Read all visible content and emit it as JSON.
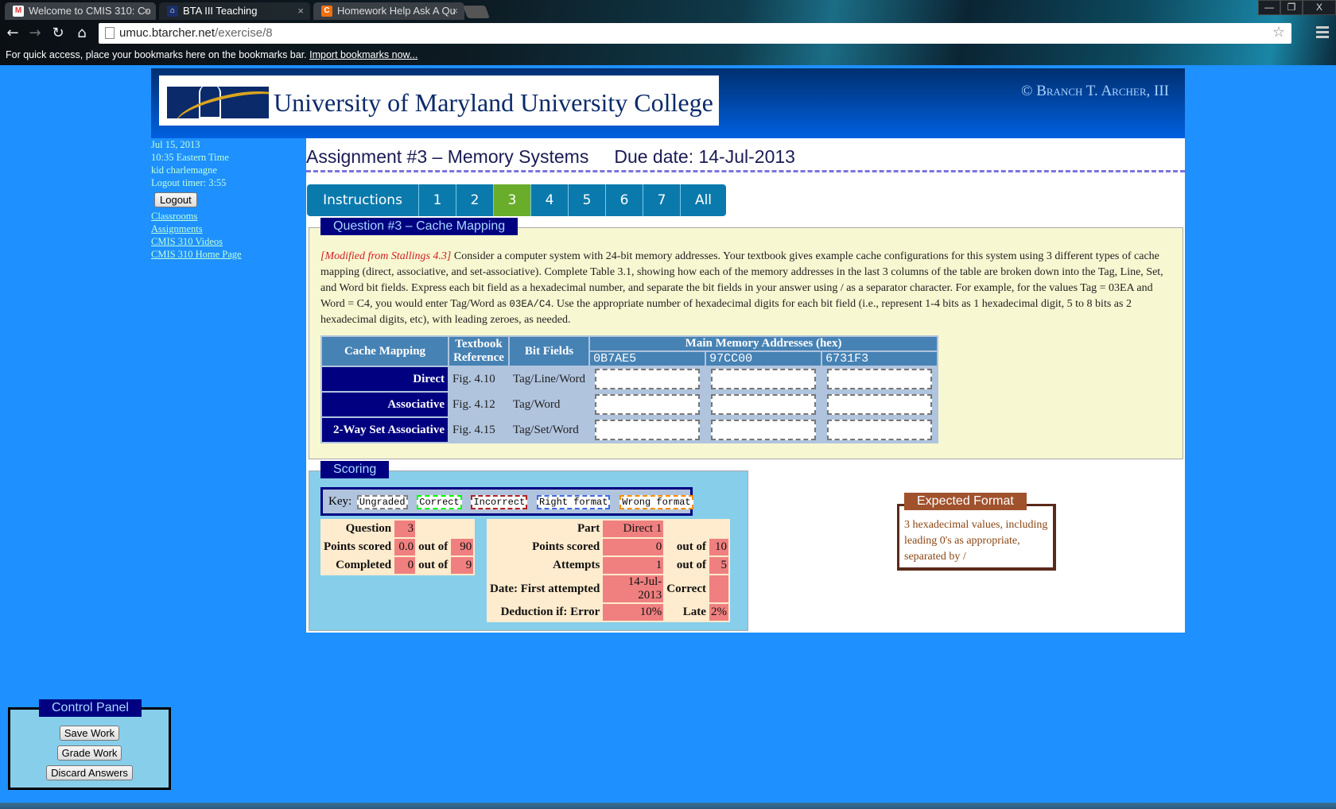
{
  "browser": {
    "tabs": [
      {
        "label": "Welcome to CMIS 310: Co",
        "icon": "gmail-icon",
        "active": false
      },
      {
        "label": "BTA III Teaching",
        "icon": "bta-icon",
        "active": true
      },
      {
        "label": "Homework Help Ask A Qu",
        "icon": "chegg-icon",
        "active": false
      }
    ],
    "url_domain": "umuc.btarcher.net",
    "url_path": "/exercise/8",
    "bookmarks_text": "For quick access, place your bookmarks here on the bookmarks bar. ",
    "bookmarks_link": "Import bookmarks now...",
    "window_controls": {
      "minimize": "—",
      "restore": "❐",
      "close": "X"
    }
  },
  "banner": {
    "logo_text": "University of Maryland University College",
    "copyright": "© Branch T. Archer, III"
  },
  "sidebar": {
    "date": "Jul 15, 2013",
    "time": "10:35 Eastern Time",
    "user": "kid charlemagne",
    "logout_timer": "Logout timer: 3:55",
    "logout_label": "Logout",
    "links": [
      "Classrooms",
      "Assignments",
      "CMIS 310 Videos",
      "CMIS 310 Home Page"
    ]
  },
  "main": {
    "title": "Assignment #3 – Memory Systems",
    "due": "Due date: 14-Jul-2013",
    "tabs": [
      {
        "label": "Instructions",
        "active": false
      },
      {
        "label": "1",
        "active": false
      },
      {
        "label": "2",
        "active": false
      },
      {
        "label": "3",
        "active": true
      },
      {
        "label": "4",
        "active": false
      },
      {
        "label": "5",
        "active": false
      },
      {
        "label": "6",
        "active": false
      },
      {
        "label": "7",
        "active": false
      },
      {
        "label": "All",
        "active": false
      }
    ]
  },
  "question": {
    "heading": "Question #3 – Cache Mapping",
    "source": "[Modified from Stallings 4.3]",
    "text1": " Consider a computer system with 24-bit memory addresses.  Your textbook gives example cache configurations for this system using 3 different types of cache mapping (direct, associative, and set-associative).  Complete Table 3.1, showing how each of the memory addresses in the last 3 columns of the table are broken down into the Tag, Line, Set, and Word bit fields.  Express each bit field as a hexadecimal number, and separate the bit fields in your answer using / as a separator character.  For example, for the values Tag = 03EA and Word = C4, you would enter Tag/Word as ",
    "example_code": "03EA/C4",
    "text2": ".  Use the appropriate number of hexadecimal digits for each bit field (i.e., represent 1-4 bits as 1 hexadecimal digit, 5 to 8 bits as 2 hexadecimal digits, etc), with leading zeroes, as needed.",
    "table": {
      "headers": {
        "mapping": "Cache Mapping",
        "reference": "Textbook Reference",
        "fields": "Bit Fields",
        "addresses": "Main Memory Addresses (hex)"
      },
      "addresses": [
        "0B7AE5",
        "97CC00",
        "6731F3"
      ],
      "rows": [
        {
          "mapping": "Direct",
          "reference": "Fig. 4.10",
          "fields": "Tag/Line/Word",
          "values": [
            "",
            "",
            ""
          ]
        },
        {
          "mapping": "Associative",
          "reference": "Fig. 4.12",
          "fields": "Tag/Word",
          "values": [
            "",
            "",
            ""
          ]
        },
        {
          "mapping": "2-Way Set Associative",
          "reference": "Fig. 4.15",
          "fields": "Tag/Set/Word",
          "values": [
            "",
            "",
            ""
          ]
        }
      ]
    }
  },
  "scoring": {
    "heading": "Scoring",
    "key_label": "Key:",
    "keys": [
      {
        "label": "Ungraded",
        "color": "#808080"
      },
      {
        "label": "Correct",
        "color": "#00ff00"
      },
      {
        "label": "Incorrect",
        "color": "#b22222"
      },
      {
        "label": "Right format",
        "color": "#4169e1"
      },
      {
        "label": "Wrong format",
        "color": "#ff8c00"
      }
    ],
    "summary": {
      "question_label": "Question",
      "question": "3",
      "points_label": "Points scored",
      "points": "0.0",
      "points_outof_label": "out of",
      "points_max": "90",
      "completed_label": "Completed",
      "completed": "0",
      "completed_outof_label": "out of",
      "completed_max": "9"
    },
    "part": {
      "part_label": "Part",
      "part": "Direct 1",
      "points_label": "Points scored",
      "points": "0",
      "points_outof_label": "out of",
      "points_max": "10",
      "attempts_label": "Attempts",
      "attempts": "1",
      "attempts_outof_label": "out of",
      "attempts_max": "5",
      "date_label": "Date: First attempted",
      "date": "14-Jul-2013",
      "correct_label": "Correct",
      "correct": "",
      "deduction_label": "Deduction if: Error",
      "deduction_error": "10%",
      "late_label": "Late",
      "deduction_late": "2%"
    }
  },
  "expected_format": {
    "heading": "Expected Format",
    "text": "3 hexadecimal values, including leading 0's as appropriate, separated by /"
  },
  "control_panel": {
    "heading": "Control Panel",
    "save": "Save Work",
    "grade": "Grade Work",
    "discard": "Discard Answers"
  }
}
